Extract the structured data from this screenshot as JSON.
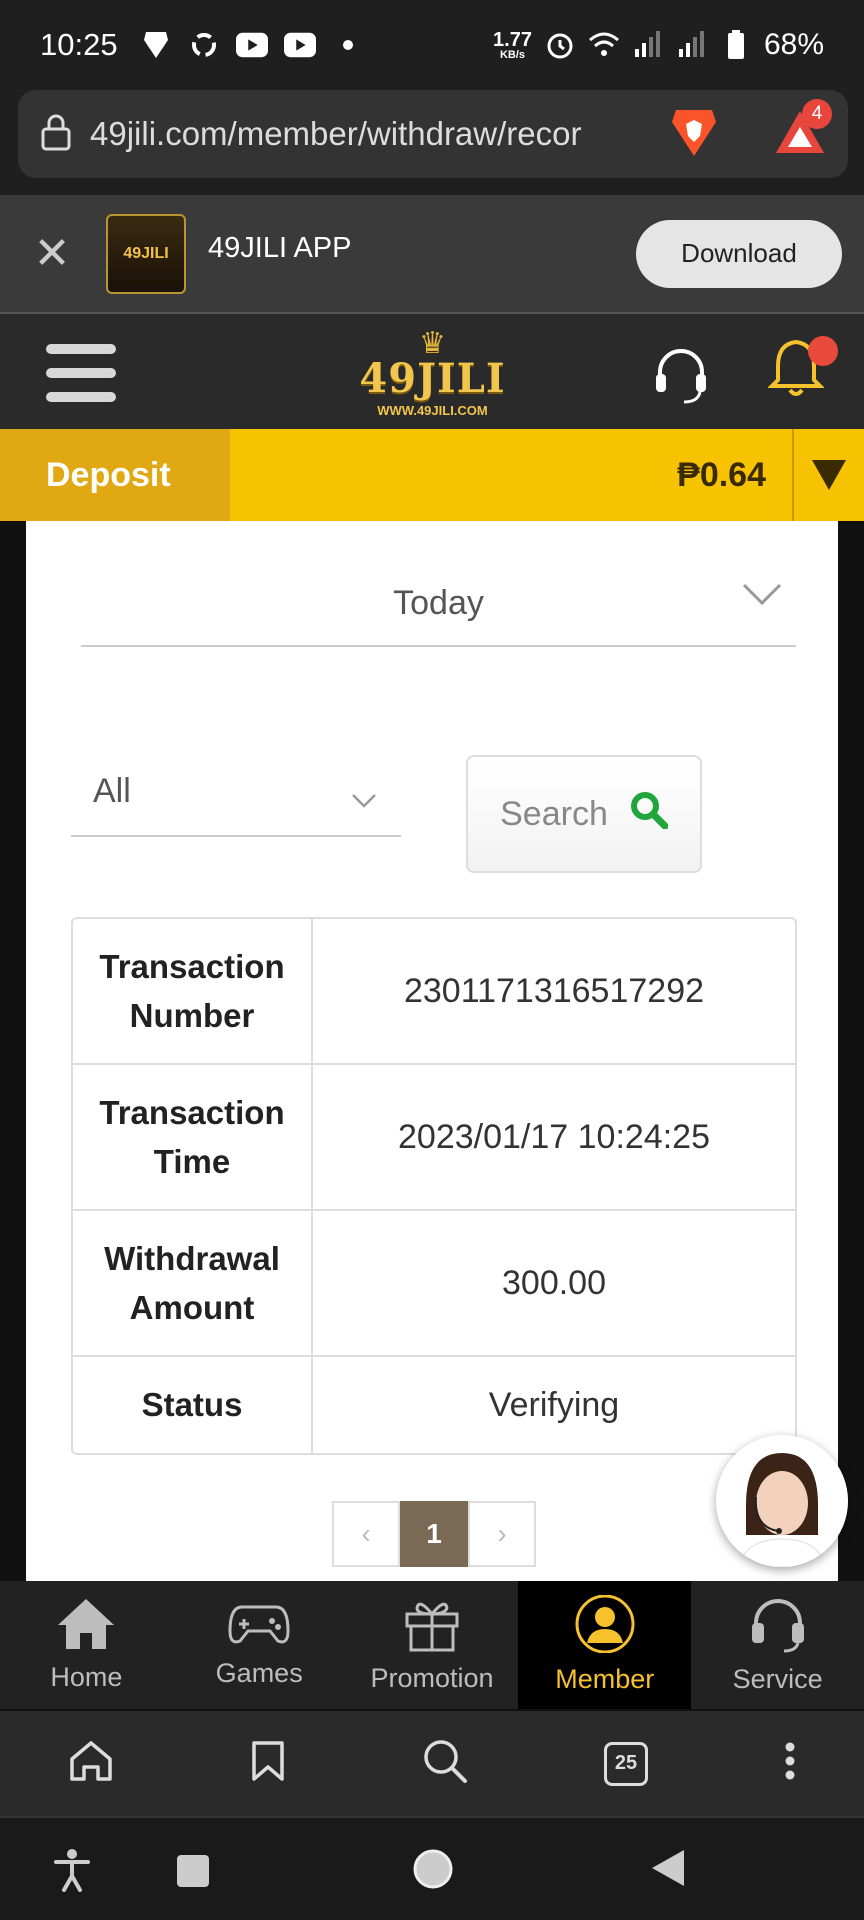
{
  "status_bar": {
    "time": "10:25",
    "net_speed": "1.77",
    "net_unit": "KB/s",
    "battery": "68%"
  },
  "browser": {
    "url": "49jili.com/member/withdraw/recor",
    "rewards_badge": "4",
    "tab_count": "25"
  },
  "app_banner": {
    "app_name": "49JILI APP",
    "download_label": "Download",
    "logo_text": "49JILI"
  },
  "header": {
    "logo_text": "49JILI",
    "logo_url": "WWW.49JILI.COM"
  },
  "deposit_bar": {
    "deposit_label": "Deposit",
    "balance": "₱0.64"
  },
  "filters": {
    "date_range": "Today",
    "type": "All",
    "search_label": "Search"
  },
  "transaction": {
    "rows": [
      {
        "label": "Transaction Number",
        "value": "2301171316517292"
      },
      {
        "label": "Transaction Time",
        "value": "2023/01/17 10:24:25"
      },
      {
        "label": "Withdrawal Amount",
        "value": "300.00"
      },
      {
        "label": "Status",
        "value": "Verifying"
      }
    ]
  },
  "pagination": {
    "prev": "‹",
    "current": "1",
    "next": "›"
  },
  "site_nav": {
    "items": [
      {
        "label": "Home"
      },
      {
        "label": "Games"
      },
      {
        "label": "Promotion"
      },
      {
        "label": "Member"
      },
      {
        "label": "Service"
      }
    ]
  },
  "colors": {
    "accent": "#f7c200",
    "deposit": "#e0a812",
    "active_nav": "#f5c12c",
    "search_icon": "#1fa53a"
  }
}
